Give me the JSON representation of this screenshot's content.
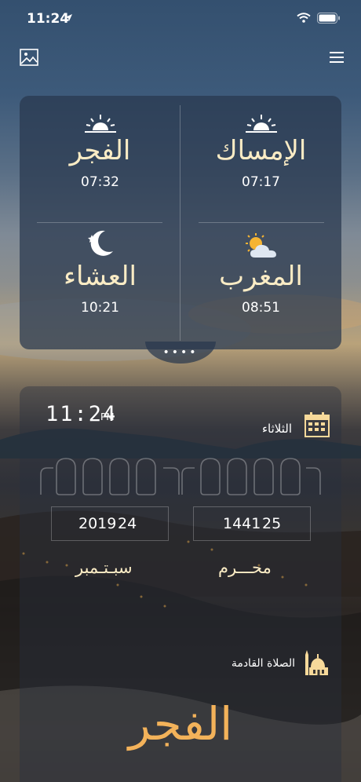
{
  "status_bar": {
    "time": "11:24"
  },
  "prayers": [
    {
      "name": "الإمساك",
      "time": "07:17",
      "icon": "sunrise-icon"
    },
    {
      "name": "الفجر",
      "time": "07:32",
      "icon": "sunrise-icon"
    },
    {
      "name": "المغرب",
      "time": "08:51",
      "icon": "cloudy-sun-icon"
    },
    {
      "name": "العشاء",
      "time": "10:21",
      "icon": "moon-star-icon"
    }
  ],
  "more_dots": "••••",
  "clock": {
    "time": "11:24",
    "ampm": "PM"
  },
  "day_name": "الثلاثاء",
  "hijri": {
    "day": "25",
    "year": "1441",
    "month": "محـــرم"
  },
  "gregorian": {
    "day": "24",
    "year": "2019",
    "month": "سبـتـمبر"
  },
  "next_prayer": {
    "label": "الصلاة القادمة",
    "name": "الفجر"
  },
  "colors": {
    "prayer_name": "#fbecc5",
    "next_prayer": "#f3b25a"
  }
}
